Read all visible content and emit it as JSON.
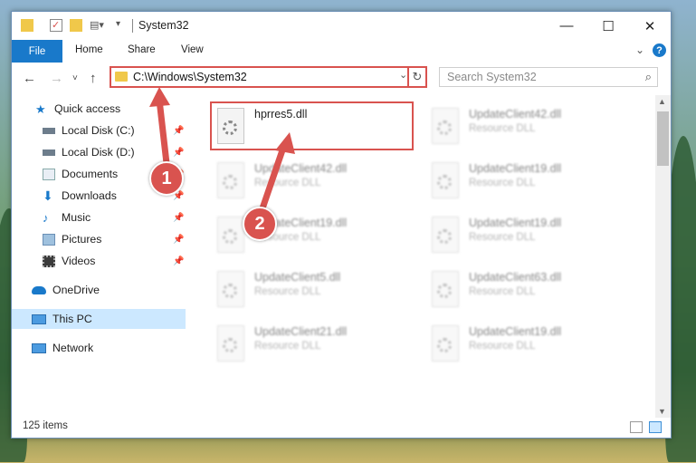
{
  "window": {
    "title": "System32",
    "controls": {
      "minimize": "—",
      "maximize": "☐",
      "close": "✕"
    }
  },
  "ribbon": {
    "tabs": [
      "File",
      "Home",
      "Share",
      "View"
    ],
    "help": "?"
  },
  "navigation": {
    "address_path": "C:\\Windows\\System32",
    "search_placeholder": "Search System32"
  },
  "sidebar": {
    "items": [
      {
        "label": "Quick access",
        "icon": "star-icon"
      },
      {
        "label": "Local Disk (C:)",
        "icon": "drive-icon",
        "pinned": true
      },
      {
        "label": "Local Disk (D:)",
        "icon": "drive-icon",
        "pinned": true
      },
      {
        "label": "Documents",
        "icon": "documents-icon",
        "pinned": true
      },
      {
        "label": "Downloads",
        "icon": "download-icon",
        "pinned": true
      },
      {
        "label": "Music",
        "icon": "music-icon",
        "pinned": true
      },
      {
        "label": "Pictures",
        "icon": "pictures-icon",
        "pinned": true
      },
      {
        "label": "Videos",
        "icon": "videos-icon",
        "pinned": true
      },
      {
        "label": "OneDrive",
        "icon": "cloud-icon"
      },
      {
        "label": "This PC",
        "icon": "computer-icon",
        "selected": true
      },
      {
        "label": "Network",
        "icon": "network-icon"
      }
    ]
  },
  "files": [
    {
      "name": "hprres5.dll",
      "type": "",
      "highlighted": true
    },
    {
      "name": "UpdateClient42.dll",
      "type": "Resource DLL"
    },
    {
      "name": "UpdateClient42.dll",
      "type": "Resource DLL"
    },
    {
      "name": "UpdateClient19.dll",
      "type": "Resource DLL"
    },
    {
      "name": "UpdateClient19.dll",
      "type": "Resource DLL"
    },
    {
      "name": "UpdateClient19.dll",
      "type": "Resource DLL"
    },
    {
      "name": "UpdateClient5.dll",
      "type": "Resource DLL"
    },
    {
      "name": "UpdateClient63.dll",
      "type": "Resource DLL"
    },
    {
      "name": "UpdateClient21.dll",
      "type": "Resource DLL"
    },
    {
      "name": "UpdateClient19.dll",
      "type": "Resource DLL"
    }
  ],
  "status": {
    "item_count": "125 items"
  },
  "annotations": {
    "step1": "1",
    "step2": "2",
    "color": "#d9534f"
  }
}
